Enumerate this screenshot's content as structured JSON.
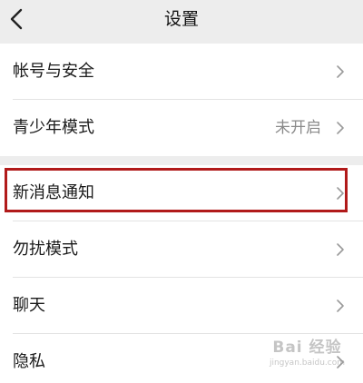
{
  "nav": {
    "title": "设置",
    "back_icon": "chevron-left-icon"
  },
  "groups": [
    {
      "items": [
        {
          "label": "帐号与安全",
          "value": ""
        },
        {
          "label": "青少年模式",
          "value": "未开启"
        }
      ]
    },
    {
      "items": [
        {
          "label": "新消息通知",
          "value": "",
          "highlighted": true
        },
        {
          "label": "勿扰模式",
          "value": ""
        },
        {
          "label": "聊天",
          "value": ""
        },
        {
          "label": "隐私",
          "value": ""
        }
      ]
    }
  ],
  "watermark": {
    "brand": "Bai 经验",
    "url": "jingyan.baidu.com"
  },
  "colors": {
    "background": "#ededed",
    "row_background": "#ffffff",
    "highlight_border": "#b11a1a",
    "secondary_text": "#8a8a8a"
  }
}
